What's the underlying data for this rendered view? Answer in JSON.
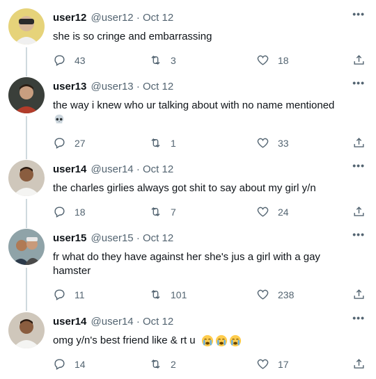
{
  "colors": {
    "text": "#0f1419",
    "secondary": "#536471",
    "thread_line": "#cfd9de"
  },
  "tweets": [
    {
      "name": "user12",
      "handle": "@user12",
      "sep": "·",
      "date": "Oct 12",
      "text": "she is so cringe and embarrassing",
      "replies": "43",
      "retweets": "3",
      "likes": "18",
      "avatar": "avatar-photo"
    },
    {
      "name": "user13",
      "handle": "@user13",
      "sep": "·",
      "date": "Oct 12",
      "text": "the way i knew who ur talking about with no name mentioned",
      "emoji": [
        "skull-emoji"
      ],
      "replies": "27",
      "retweets": "1",
      "likes": "33",
      "avatar": "avatar-photo"
    },
    {
      "name": "user14",
      "handle": "@user14",
      "sep": "·",
      "date": "Oct 12",
      "text": "the charles girlies always got shit to say about my girl y/n",
      "replies": "18",
      "retweets": "7",
      "likes": "24",
      "avatar": "avatar-photo"
    },
    {
      "name": "user15",
      "handle": "@user15",
      "sep": "·",
      "date": "Oct 12",
      "text": "fr what do they have against her she's jus a girl with a gay hamster",
      "replies": "11",
      "retweets": "101",
      "likes": "238",
      "avatar": "avatar-photo"
    },
    {
      "name": "user14",
      "handle": "@user14",
      "sep": "·",
      "date": "Oct 12",
      "text": "omg y/n's best friend like & rt u",
      "emoji": [
        "crying-emoji",
        "crying-emoji",
        "crying-emoji"
      ],
      "replies": "14",
      "retweets": "2",
      "likes": "17",
      "avatar": "avatar-photo"
    }
  ],
  "icons": {
    "more": "more-icon",
    "reply": "reply-icon",
    "retweet": "retweet-icon",
    "like": "heart-icon",
    "share": "share-icon"
  }
}
